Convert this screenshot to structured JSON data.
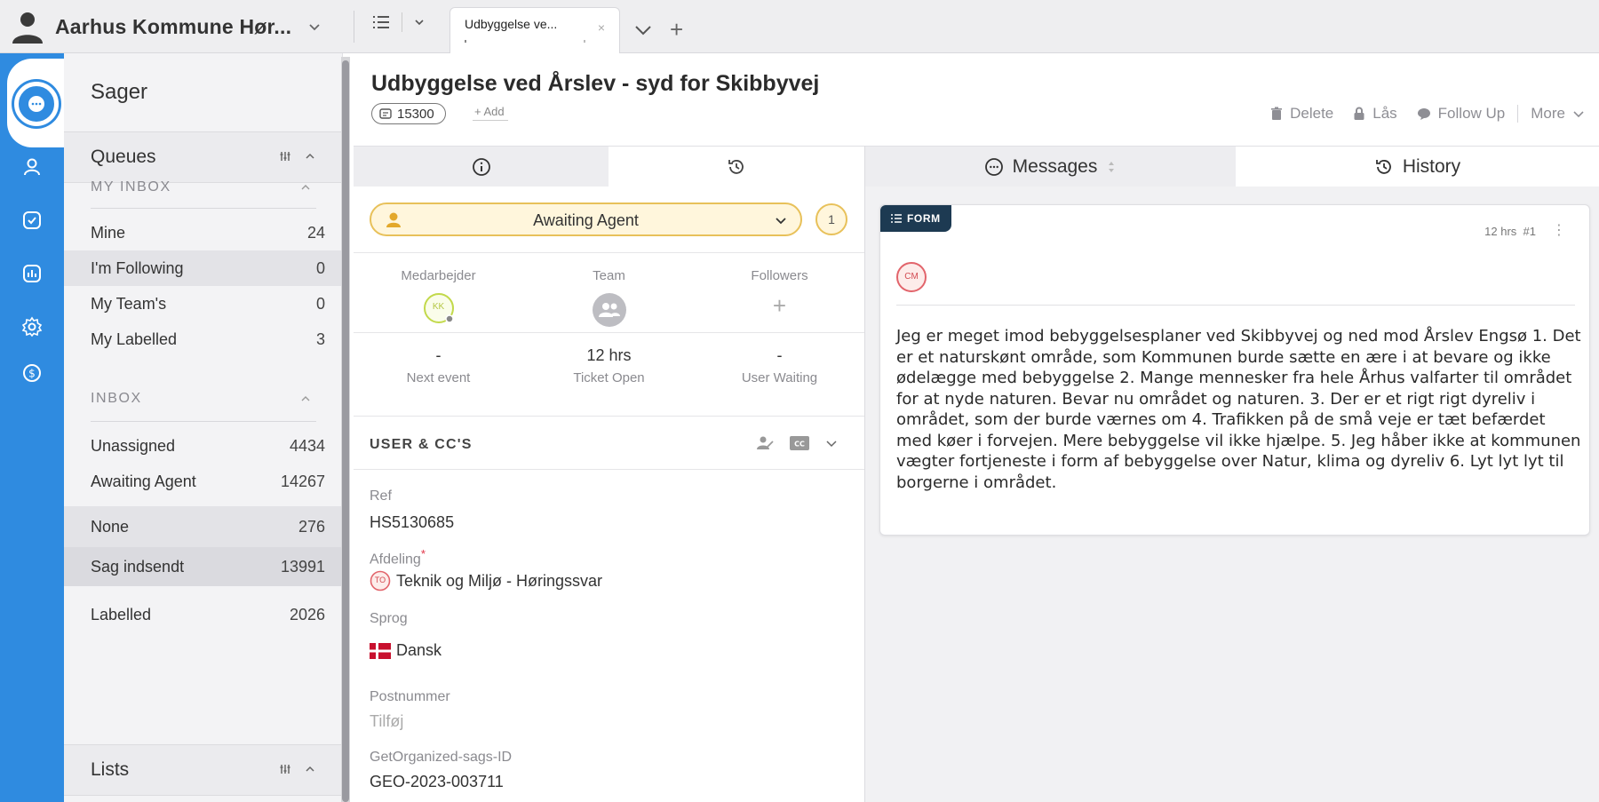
{
  "colors": {
    "accent": "#2f8be0",
    "status_yellow": "#e8c15a",
    "status_fill": "#fff6dc",
    "form_badge": "#1d3a52",
    "danger": "#e0384a"
  },
  "topbar": {
    "org_name": "Aarhus Kommune Hør...",
    "active_tab": {
      "title": "Udbyggelse ve...",
      "close": "×"
    },
    "new_tab": "+"
  },
  "rail": {
    "icons": [
      "chat-icon",
      "user-icon",
      "check-square-icon",
      "chart-icon",
      "gear-icon",
      "dollar-icon"
    ]
  },
  "sidebar": {
    "title": "Sager",
    "queues_label": "Queues",
    "my_inbox": {
      "label": "MY INBOX",
      "items": [
        {
          "label": "Mine",
          "count": "24"
        },
        {
          "label": "I'm Following",
          "count": "0"
        },
        {
          "label": "My Team's",
          "count": "0"
        },
        {
          "label": "My Labelled",
          "count": "3"
        }
      ]
    },
    "inbox": {
      "label": "INBOX",
      "items": [
        {
          "label": "Unassigned",
          "count": "4434"
        },
        {
          "label": "Awaiting Agent",
          "count": "14267"
        },
        {
          "label": "None",
          "count": "276"
        },
        {
          "label": "Sag indsendt",
          "count": "13991"
        },
        {
          "label": "Labelled",
          "count": "2026"
        }
      ]
    },
    "lists_label": "Lists"
  },
  "ticket": {
    "title": "Udbyggelse ved Årslev - syd for Skibbyvej",
    "id": "15300",
    "add_label": "+ Add",
    "actions": {
      "delete": "Delete",
      "lock": "Lås",
      "follow_up": "Follow Up",
      "more": "More"
    }
  },
  "details": {
    "status": "Awaiting Agent",
    "status_count": "1",
    "medarbejder_label": "Medarbejder",
    "medarbejder_initials": "KK",
    "team_label": "Team",
    "followers_label": "Followers",
    "followers_add": "+",
    "next_event_value": "-",
    "next_event_label": "Next event",
    "ticket_open_value": "12 hrs",
    "ticket_open_label": "Ticket Open",
    "user_waiting_value": "-",
    "user_waiting_label": "User Waiting",
    "user_cc_label": "USER & CC'S",
    "cc_badge": "CC",
    "fields": {
      "ref_label": "Ref",
      "ref_value": "HS5130685",
      "afdeling_label": "Afdeling",
      "afdeling_required": "*",
      "afdeling_badge": "TO",
      "afdeling_value": "Teknik og Miljø - Høringssvar",
      "sprog_label": "Sprog",
      "sprog_value": "Dansk",
      "postnummer_label": "Postnummer",
      "postnummer_placeholder": "Tilføj",
      "geo_label": "GetOrganized-sags-ID",
      "geo_value": "GEO-2023-003711"
    }
  },
  "messages": {
    "tab_messages": "Messages",
    "tab_history": "History",
    "card": {
      "badge": "FORM",
      "meta": "12 hrs  #1",
      "kebab": "⋮",
      "avatar_initials": "CM",
      "body": "Jeg er meget imod bebyggelsesplaner ved Skibbyvej og ned mod Årslev Engsø 1. Det er et naturskønt område, som Kommunen burde sætte en ære i at bevare og ikke ødelægge med bebyggelse 2. Mange mennesker fra hele Århus valfarter til området for at nyde naturen. Bevar nu området og naturen. 3. Der er et rigt rigt dyreliv i området, som der burde værnes om 4. Trafikken på de små veje er tæt befærdet med køer i forvejen. Mere bebyggelse vil ikke hjælpe. 5. Jeg håber ikke at kommunen vægter fortjeneste i form af bebyggelse over Natur, klima og dyreliv 6. Lyt lyt lyt til borgerne i området."
    }
  }
}
